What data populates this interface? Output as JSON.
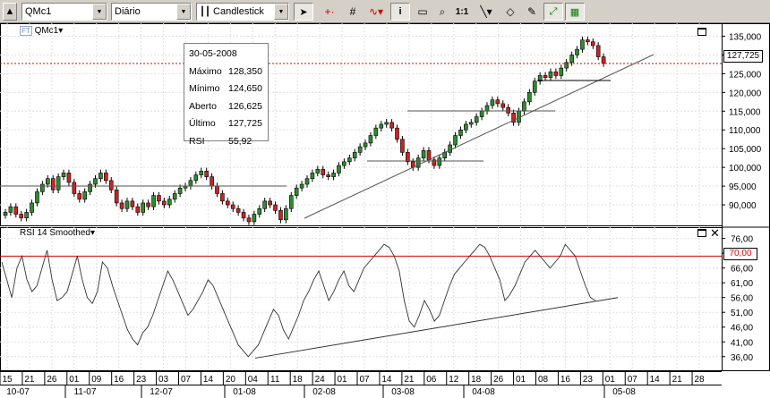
{
  "toolbar": {
    "symbol": "QMc1",
    "period": "Diário",
    "chart_type": "Candlestick",
    "zoom_label": "1:1"
  },
  "chart_data": [
    {
      "type": "candlestick",
      "symbol_label": "QMc1",
      "y_ticks": [
        135000,
        130000,
        125000,
        120000,
        115000,
        110000,
        105000,
        100000,
        95000,
        90000
      ],
      "y_tick_labels": [
        "135,000",
        "130,000",
        "125,000",
        "120,000",
        "115,000",
        "110,000",
        "105,000",
        "100,000",
        "95,000",
        "90,000"
      ],
      "ylim": [
        85000,
        137500
      ],
      "last_price_label": "127,725",
      "last_price": 127725,
      "close_series": [
        88000,
        89500,
        87500,
        86500,
        88000,
        90500,
        93500,
        95500,
        97000,
        94000,
        97500,
        98500,
        96000,
        93000,
        91500,
        93500,
        95500,
        97000,
        98500,
        96500,
        94000,
        90500,
        89000,
        91000,
        89500,
        88000,
        90500,
        89500,
        92500,
        91000,
        90000,
        91500,
        93000,
        94500,
        95000,
        96500,
        98000,
        99000,
        97500,
        95000,
        93000,
        91000,
        90000,
        89000,
        88000,
        86500,
        85500,
        87500,
        89000,
        91000,
        90000,
        88500,
        86000,
        89000,
        92500,
        94500,
        95500,
        97000,
        98500,
        99500,
        98000,
        97500,
        98500,
        100500,
        101500,
        102500,
        104000,
        105500,
        106500,
        108500,
        110500,
        111500,
        112000,
        110500,
        107500,
        104000,
        101500,
        100000,
        102500,
        104500,
        102000,
        100500,
        102500,
        104000,
        106000,
        108500,
        110000,
        111500,
        112000,
        113500,
        115000,
        116500,
        118000,
        117000,
        116000,
        114500,
        112000,
        115000,
        117500,
        120000,
        123000,
        124500,
        124000,
        125500,
        124500,
        126500,
        128000,
        130000,
        131500,
        134000,
        133500,
        132500,
        129500,
        127725
      ],
      "info": {
        "date": "30-05-2008",
        "rows": [
          {
            "label": "Máximo",
            "value": "128,350"
          },
          {
            "label": "Mínimo",
            "value": "124,650"
          },
          {
            "label": "Aberto",
            "value": "126,625"
          },
          {
            "label": "Último",
            "value": "127,725"
          },
          {
            "label": "RSI",
            "value": "55,92"
          }
        ]
      }
    },
    {
      "type": "line",
      "indicator_label": "RSI 14 Smoothed",
      "y_ticks": [
        76,
        71,
        66,
        61,
        56,
        51,
        46,
        41,
        36
      ],
      "y_tick_labels": [
        "76,00",
        "71,00",
        "66,00",
        "61,00",
        "56,00",
        "51,00",
        "46,00",
        "41,00",
        "36,00"
      ],
      "ylim": [
        32,
        78
      ],
      "threshold": 70,
      "threshold_label": "70,00",
      "values": [
        68,
        62,
        56,
        66,
        70,
        62,
        58,
        60,
        66,
        72,
        62,
        55,
        56,
        58,
        64,
        70,
        62,
        56,
        54,
        58,
        68,
        66,
        60,
        55,
        50,
        45,
        42,
        40,
        44,
        46,
        50,
        55,
        60,
        65,
        62,
        58,
        54,
        50,
        52,
        55,
        58,
        62,
        60,
        56,
        52,
        48,
        44,
        40,
        38,
        36,
        38,
        40,
        44,
        48,
        52,
        50,
        45,
        42,
        46,
        50,
        55,
        58,
        62,
        65,
        60,
        55,
        58,
        62,
        65,
        60,
        58,
        62,
        66,
        68,
        70,
        72,
        74,
        73,
        70,
        65,
        55,
        48,
        46,
        50,
        55,
        52,
        48,
        50,
        55,
        60,
        64,
        66,
        68,
        70,
        72,
        74,
        73,
        70,
        66,
        62,
        55,
        57,
        60,
        64,
        68,
        70,
        72,
        70,
        68,
        66,
        68,
        70,
        74,
        72,
        70,
        65,
        60,
        56,
        55
      ]
    }
  ],
  "x_axis": {
    "days": [
      "15",
      "21",
      "26",
      "01",
      "09",
      "16",
      "23",
      "03",
      "07",
      "14",
      "20",
      "04",
      "11",
      "18",
      "24",
      "01",
      "07",
      "14",
      "21",
      "06",
      "12",
      "18",
      "26",
      "01",
      "08",
      "16",
      "23",
      "01",
      "07",
      "14",
      "21",
      "28"
    ],
    "months": [
      "10-07",
      "11-07",
      "12-07",
      "01-08",
      "02-08",
      "03-08",
      "04-08",
      "05-08"
    ]
  }
}
